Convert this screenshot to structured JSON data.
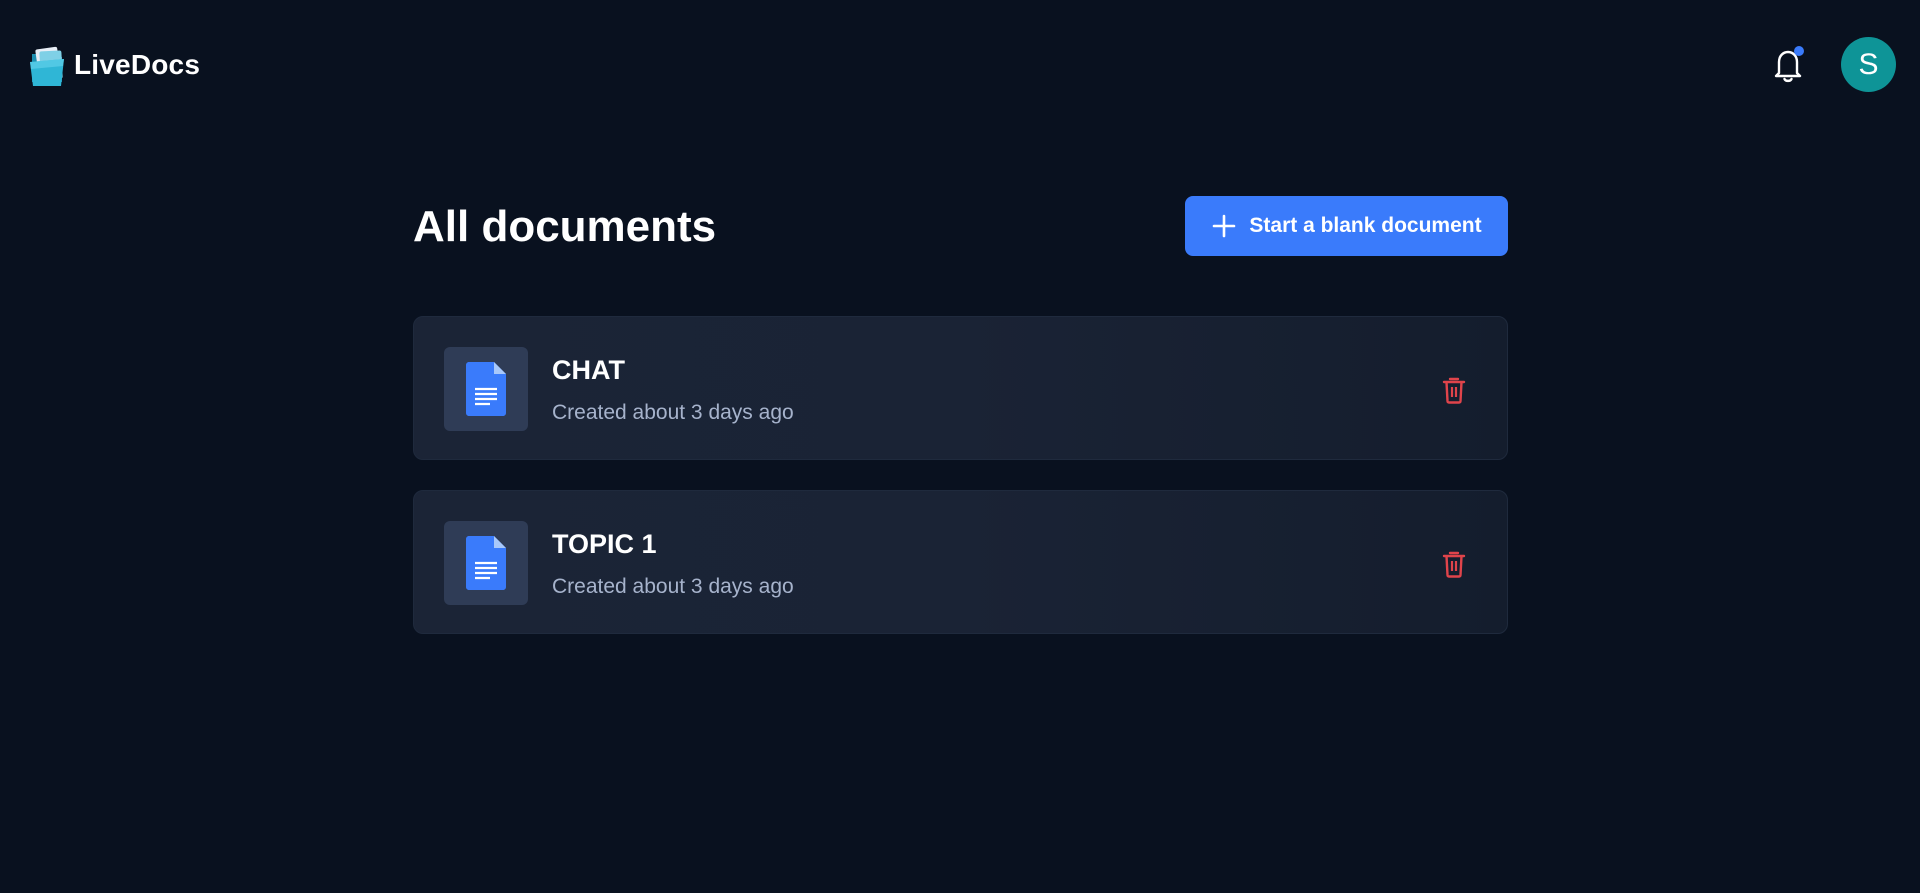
{
  "app": {
    "name": "LiveDocs",
    "logo_icon": "folder-docs-icon"
  },
  "header": {
    "notifications_icon": "bell-icon",
    "has_unread": true,
    "avatar_initial": "S",
    "avatar_color": "#0e9497"
  },
  "main": {
    "title": "All documents",
    "new_doc_button": {
      "label": "Start a blank document",
      "icon": "plus-icon"
    },
    "documents": [
      {
        "title": "CHAT",
        "meta": "Created about 3 days ago",
        "icon": "document-icon",
        "delete_icon": "trash-icon"
      },
      {
        "title": "TOPIC 1",
        "meta": "Created about 3 days ago",
        "icon": "document-icon",
        "delete_icon": "trash-icon"
      }
    ]
  },
  "colors": {
    "background": "#09111f",
    "accent": "#3a7bfb",
    "danger": "#e0444b",
    "card": "#1a2335"
  }
}
